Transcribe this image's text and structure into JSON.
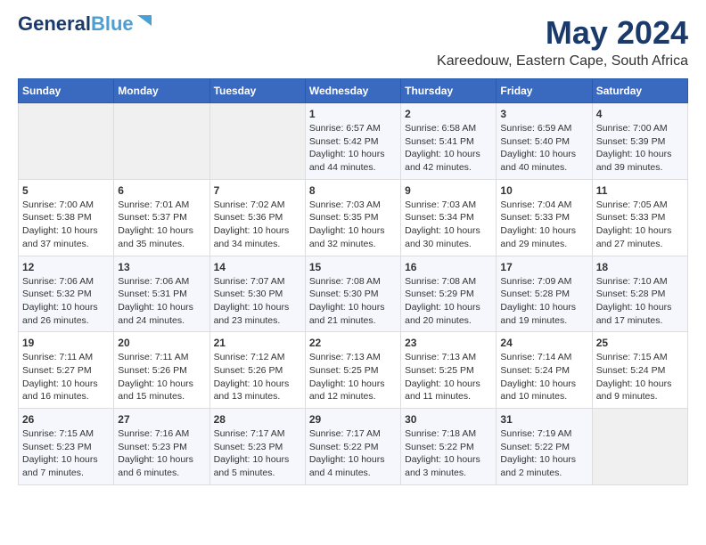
{
  "header": {
    "logo_line1": "General",
    "logo_line2": "Blue",
    "month": "May 2024",
    "location": "Kareedouw, Eastern Cape, South Africa"
  },
  "days_of_week": [
    "Sunday",
    "Monday",
    "Tuesday",
    "Wednesday",
    "Thursday",
    "Friday",
    "Saturday"
  ],
  "weeks": [
    [
      {
        "day": "",
        "content": ""
      },
      {
        "day": "",
        "content": ""
      },
      {
        "day": "",
        "content": ""
      },
      {
        "day": "1",
        "content": "Sunrise: 6:57 AM\nSunset: 5:42 PM\nDaylight: 10 hours\nand 44 minutes."
      },
      {
        "day": "2",
        "content": "Sunrise: 6:58 AM\nSunset: 5:41 PM\nDaylight: 10 hours\nand 42 minutes."
      },
      {
        "day": "3",
        "content": "Sunrise: 6:59 AM\nSunset: 5:40 PM\nDaylight: 10 hours\nand 40 minutes."
      },
      {
        "day": "4",
        "content": "Sunrise: 7:00 AM\nSunset: 5:39 PM\nDaylight: 10 hours\nand 39 minutes."
      }
    ],
    [
      {
        "day": "5",
        "content": "Sunrise: 7:00 AM\nSunset: 5:38 PM\nDaylight: 10 hours\nand 37 minutes."
      },
      {
        "day": "6",
        "content": "Sunrise: 7:01 AM\nSunset: 5:37 PM\nDaylight: 10 hours\nand 35 minutes."
      },
      {
        "day": "7",
        "content": "Sunrise: 7:02 AM\nSunset: 5:36 PM\nDaylight: 10 hours\nand 34 minutes."
      },
      {
        "day": "8",
        "content": "Sunrise: 7:03 AM\nSunset: 5:35 PM\nDaylight: 10 hours\nand 32 minutes."
      },
      {
        "day": "9",
        "content": "Sunrise: 7:03 AM\nSunset: 5:34 PM\nDaylight: 10 hours\nand 30 minutes."
      },
      {
        "day": "10",
        "content": "Sunrise: 7:04 AM\nSunset: 5:33 PM\nDaylight: 10 hours\nand 29 minutes."
      },
      {
        "day": "11",
        "content": "Sunrise: 7:05 AM\nSunset: 5:33 PM\nDaylight: 10 hours\nand 27 minutes."
      }
    ],
    [
      {
        "day": "12",
        "content": "Sunrise: 7:06 AM\nSunset: 5:32 PM\nDaylight: 10 hours\nand 26 minutes."
      },
      {
        "day": "13",
        "content": "Sunrise: 7:06 AM\nSunset: 5:31 PM\nDaylight: 10 hours\nand 24 minutes."
      },
      {
        "day": "14",
        "content": "Sunrise: 7:07 AM\nSunset: 5:30 PM\nDaylight: 10 hours\nand 23 minutes."
      },
      {
        "day": "15",
        "content": "Sunrise: 7:08 AM\nSunset: 5:30 PM\nDaylight: 10 hours\nand 21 minutes."
      },
      {
        "day": "16",
        "content": "Sunrise: 7:08 AM\nSunset: 5:29 PM\nDaylight: 10 hours\nand 20 minutes."
      },
      {
        "day": "17",
        "content": "Sunrise: 7:09 AM\nSunset: 5:28 PM\nDaylight: 10 hours\nand 19 minutes."
      },
      {
        "day": "18",
        "content": "Sunrise: 7:10 AM\nSunset: 5:28 PM\nDaylight: 10 hours\nand 17 minutes."
      }
    ],
    [
      {
        "day": "19",
        "content": "Sunrise: 7:11 AM\nSunset: 5:27 PM\nDaylight: 10 hours\nand 16 minutes."
      },
      {
        "day": "20",
        "content": "Sunrise: 7:11 AM\nSunset: 5:26 PM\nDaylight: 10 hours\nand 15 minutes."
      },
      {
        "day": "21",
        "content": "Sunrise: 7:12 AM\nSunset: 5:26 PM\nDaylight: 10 hours\nand 13 minutes."
      },
      {
        "day": "22",
        "content": "Sunrise: 7:13 AM\nSunset: 5:25 PM\nDaylight: 10 hours\nand 12 minutes."
      },
      {
        "day": "23",
        "content": "Sunrise: 7:13 AM\nSunset: 5:25 PM\nDaylight: 10 hours\nand 11 minutes."
      },
      {
        "day": "24",
        "content": "Sunrise: 7:14 AM\nSunset: 5:24 PM\nDaylight: 10 hours\nand 10 minutes."
      },
      {
        "day": "25",
        "content": "Sunrise: 7:15 AM\nSunset: 5:24 PM\nDaylight: 10 hours\nand 9 minutes."
      }
    ],
    [
      {
        "day": "26",
        "content": "Sunrise: 7:15 AM\nSunset: 5:23 PM\nDaylight: 10 hours\nand 7 minutes."
      },
      {
        "day": "27",
        "content": "Sunrise: 7:16 AM\nSunset: 5:23 PM\nDaylight: 10 hours\nand 6 minutes."
      },
      {
        "day": "28",
        "content": "Sunrise: 7:17 AM\nSunset: 5:23 PM\nDaylight: 10 hours\nand 5 minutes."
      },
      {
        "day": "29",
        "content": "Sunrise: 7:17 AM\nSunset: 5:22 PM\nDaylight: 10 hours\nand 4 minutes."
      },
      {
        "day": "30",
        "content": "Sunrise: 7:18 AM\nSunset: 5:22 PM\nDaylight: 10 hours\nand 3 minutes."
      },
      {
        "day": "31",
        "content": "Sunrise: 7:19 AM\nSunset: 5:22 PM\nDaylight: 10 hours\nand 2 minutes."
      },
      {
        "day": "",
        "content": ""
      }
    ]
  ]
}
